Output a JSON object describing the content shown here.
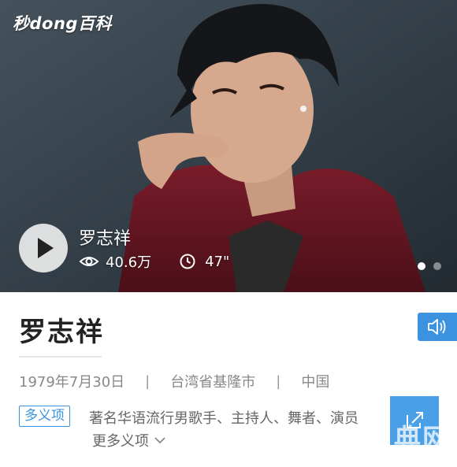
{
  "hero": {
    "brand": "秒dong百科",
    "video_title": "罗志祥",
    "views": "40.6万",
    "duration": "47\"",
    "carousel": {
      "total": 2,
      "active": 0
    }
  },
  "entry": {
    "name": "罗志祥",
    "birth_date": "1979年7月30日",
    "separator": "|",
    "birthplace": "台湾省基隆市",
    "nationality": "中国",
    "polysemy_label": "多义项",
    "polysemy_desc": "著名华语流行男歌手、主持人、舞者、演员",
    "more_meanings": "更多义项"
  },
  "watermark": "典网",
  "colors": {
    "accent": "#3b93e0",
    "share_button": "#4aa0e6",
    "title": "#222222",
    "meta_text": "#888888"
  },
  "icons": {
    "play": "play-icon",
    "views": "eye-icon",
    "duration": "clock-icon",
    "speaker": "speaker-icon",
    "share": "share-icon",
    "more": "chevron-down-icon"
  }
}
